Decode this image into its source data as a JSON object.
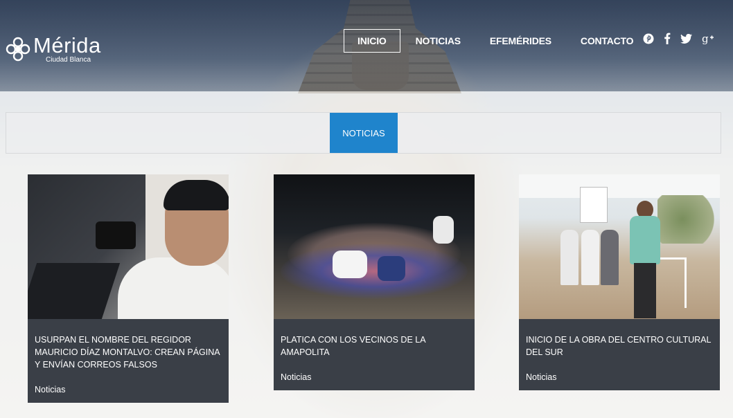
{
  "header": {
    "logo": {
      "title": "Mérida",
      "subtitle": "Ciudad Blanca"
    },
    "nav": [
      {
        "label": "INICIO",
        "active": true
      },
      {
        "label": "NOTICIAS",
        "active": false
      },
      {
        "label": "EFEMÉRIDES",
        "active": false
      },
      {
        "label": "CONTACTO",
        "active": false
      }
    ],
    "social": [
      "pinterest-icon",
      "facebook-icon",
      "twitter-icon",
      "google-plus-icon"
    ]
  },
  "tabs": [
    {
      "label": "NOTICIAS",
      "active": true
    }
  ],
  "colors": {
    "accent": "#1f84cc",
    "card_bg": "#3a3f47"
  },
  "cards": [
    {
      "title": "USURPAN EL NOMBRE DEL REGIDOR MAURICIO DÍAZ MONTALVO: CREAN PÁGINA Y ENVÍAN CORREOS FALSOS",
      "category": "Noticias"
    },
    {
      "title": "PLATICA CON LOS VECINOS DE LA AMAPOLITA",
      "category": "Noticias"
    },
    {
      "title": "INICIO DE LA OBRA DEL CENTRO CULTURAL DEL SUR",
      "category": "Noticias"
    }
  ]
}
